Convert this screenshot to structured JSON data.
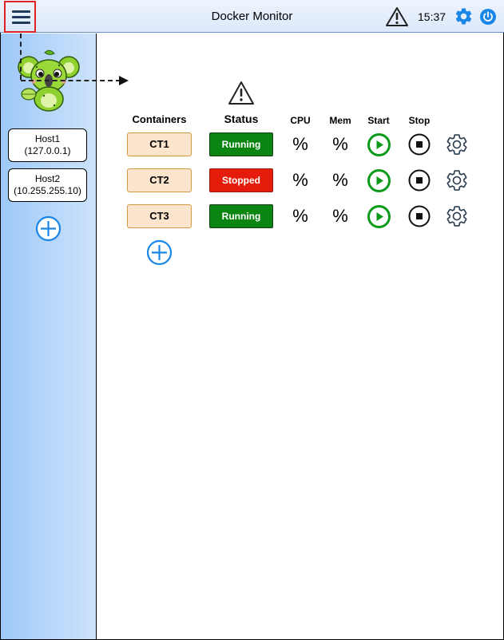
{
  "header": {
    "title": "Docker Monitor",
    "clock": "15:37",
    "icons": [
      "menu-icon",
      "warning-icon",
      "gear-icon",
      "power-icon"
    ]
  },
  "sidebar": {
    "hosts": [
      {
        "name": "Host1",
        "address": "(127.0.0.1)"
      },
      {
        "name": "Host2",
        "address": "(10.255.255.10)"
      }
    ]
  },
  "table": {
    "headers": {
      "containers": "Containers",
      "status": "Status",
      "cpu": "CPU",
      "mem": "Mem",
      "start": "Start",
      "stop": "Stop"
    },
    "rows": [
      {
        "name": "CT1",
        "status": "Running",
        "cpu": "%",
        "mem": "%"
      },
      {
        "name": "CT2",
        "status": "Stopped",
        "cpu": "%",
        "mem": "%"
      },
      {
        "name": "CT3",
        "status": "Running",
        "cpu": "%",
        "mem": "%"
      }
    ]
  },
  "colors": {
    "running": "#0b8512",
    "stopped": "#e51c0b",
    "accent": "#1a86e8",
    "container_bg": "#fde4cd"
  }
}
